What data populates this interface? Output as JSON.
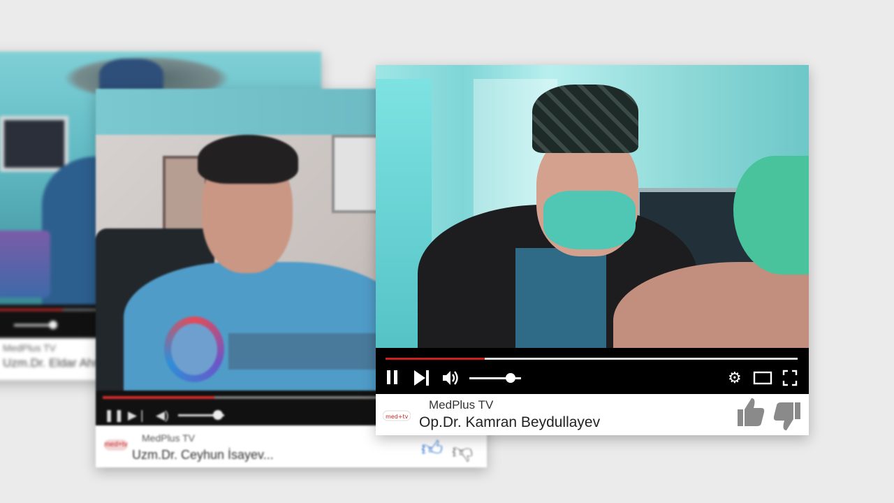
{
  "back_card": {
    "channel": "MedPlus TV",
    "title": "Uzm.Dr. Eldar Ahmad..."
  },
  "middle_card": {
    "logo_text": "med+tv",
    "channel": "MedPlus TV",
    "title": "Uzm.Dr. Ceyhun İsayev..."
  },
  "front_card": {
    "logo_text": "med+tv",
    "channel": "MedPlus TV",
    "title": "Op.Dr. Kamran Beydullayev",
    "progress_fraction": 0.24,
    "volume_fraction": 0.8,
    "accent_color": "#cc1f1f",
    "icons": [
      "pause-icon",
      "next-icon",
      "volume-icon",
      "settings-icon",
      "theater-mode-icon",
      "fullscreen-icon",
      "thumbs-up-icon",
      "thumbs-down-icon"
    ]
  }
}
